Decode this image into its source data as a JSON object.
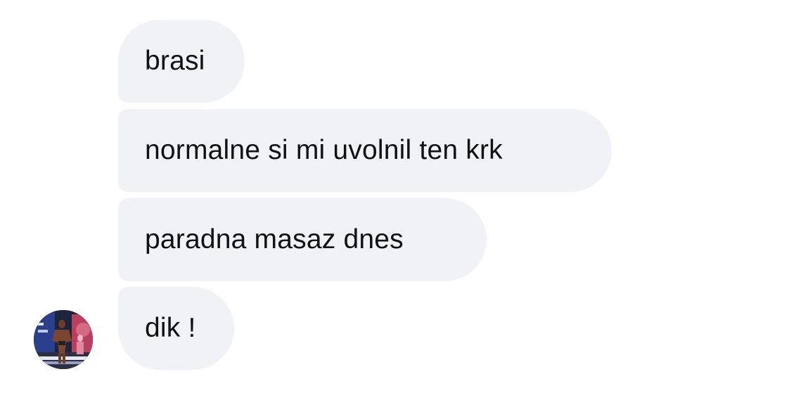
{
  "conversation": {
    "messages": [
      {
        "text": "brasi"
      },
      {
        "text": "normalne si mi uvolnil ten krk"
      },
      {
        "text": "paradna masaz dnes"
      },
      {
        "text": "dik !"
      }
    ],
    "bubble_color": "#f1f2f6",
    "text_color": "#111111"
  },
  "avatar": {
    "icon": "profile-photo-bodybuilder-on-stage",
    "accent_colors": [
      "#1d2440",
      "#c5415c",
      "#3a60c8"
    ]
  }
}
